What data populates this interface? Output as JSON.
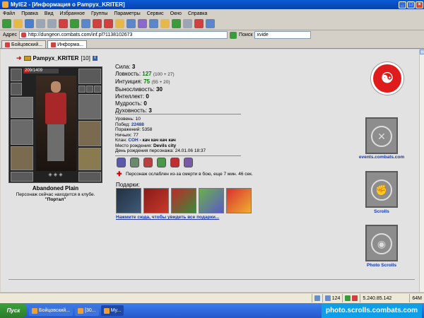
{
  "window": {
    "title": "MyIE2 - [Информация о Pampyx_KRITER]"
  },
  "menu": [
    "Файл",
    "Правка",
    "Вид",
    "Избранное",
    "Группы",
    "Параметры",
    "Сервис",
    "Окно",
    "Справка"
  ],
  "address": {
    "label": "Адрес",
    "url": "http://dungeon.combats.com/inf.pl?1138102673",
    "search_label": "Поиск",
    "search_value": "xvide"
  },
  "tabs": [
    {
      "label": "Бойцовский..."
    },
    {
      "label": "Информа..."
    }
  ],
  "character": {
    "name": "Pampyx_KRITER",
    "level": "[10]",
    "hp_text": "209/1409",
    "hp_fraction": 0.15,
    "location": "Abandoned Plain",
    "club_note": "Персонаж сейчас находится в клубе.",
    "club_name": "\"Портал\""
  },
  "stats": [
    {
      "label": "Сила:",
      "value": "3",
      "extra": "",
      "green": false
    },
    {
      "label": "Ловкость:",
      "value": "127",
      "extra": "(100 + 27)",
      "green": true
    },
    {
      "label": "Интуиция:",
      "value": "75",
      "extra": "(55 + 20)",
      "green": true
    },
    {
      "label": "Выносливость:",
      "value": "30",
      "extra": "",
      "green": false
    },
    {
      "label": "Интеллект:",
      "value": "0",
      "extra": "",
      "green": false
    },
    {
      "label": "Мудрость:",
      "value": "0",
      "extra": "",
      "green": false
    },
    {
      "label": "Духовность:",
      "value": "3",
      "extra": "",
      "green": false
    }
  ],
  "info": {
    "level": {
      "label": "Уровень:",
      "value": "10"
    },
    "wins": {
      "label": "Побед:",
      "value": "22488"
    },
    "losses": {
      "label": "Поражений:",
      "value": "5358"
    },
    "draws": {
      "label": "Ничьих:",
      "value": "77"
    },
    "clan": {
      "label": "Клан:",
      "value": "СОН",
      "extra": "- кач кач кач кач"
    },
    "birthplace": {
      "label": "Место рождения:",
      "value": "Devils city"
    },
    "birthday": {
      "label": "День рождения персонажа:",
      "value": "24.01.06 18:37"
    }
  },
  "weakened_text": "Персонаж ослаблен из-за смерти в бою, еще 7 мин. 46 сек.",
  "gifts": {
    "label": "Подарки:",
    "link": "Нажмите сюда, чтобы увидеть все подарки..."
  },
  "right_links": {
    "events": "events.combats.com",
    "scrolls": "Scrolls",
    "photo": "Photo Scrolls"
  },
  "statusbar": {
    "zoom": "124",
    "ip": "5.240.85.142",
    "mem": "64M"
  },
  "taskbar": {
    "start": "Пуск",
    "tasks": [
      "Бойцовский...",
      "[30...",
      "My..."
    ],
    "tray": "photo.scrolls.combats.com"
  },
  "colors": {
    "hp": "#c01818",
    "stat_green": "#117711",
    "link_blue": "#1838a8",
    "logo_red": "#e01b1b"
  }
}
